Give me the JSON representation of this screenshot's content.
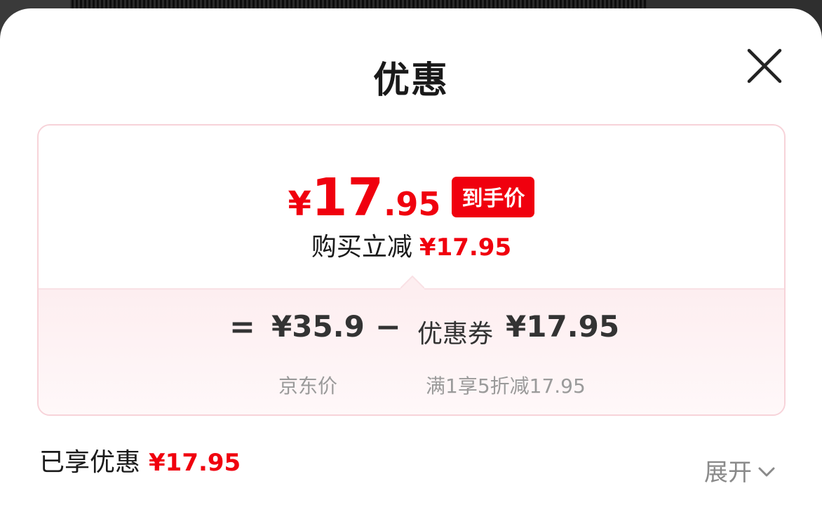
{
  "sheet": {
    "title": "优惠"
  },
  "card": {
    "price": {
      "currency": "¥",
      "integer": "17",
      "decimal": ".95"
    },
    "price_badge": "到手价",
    "reduce_label": "购买立减",
    "reduce_amount": "¥17.95",
    "equation": {
      "equals": "=",
      "jd_price": "¥35.9",
      "minus": "−",
      "coupon_label": "优惠券",
      "coupon_amount": "¥17.95"
    },
    "sub": {
      "jd_price_label": "京东价",
      "coupon_rule": "满1享5折减17.95"
    }
  },
  "summary": {
    "enjoyed_label": "已享优惠",
    "enjoyed_amount": "¥17.95",
    "expand_label": "展开"
  },
  "colors": {
    "accent": "#f0000e",
    "card_border": "#f7d3d9",
    "card_tint": "#fdeef0"
  },
  "icons": {
    "close": "close-icon",
    "expand": "chevron-down-icon"
  }
}
